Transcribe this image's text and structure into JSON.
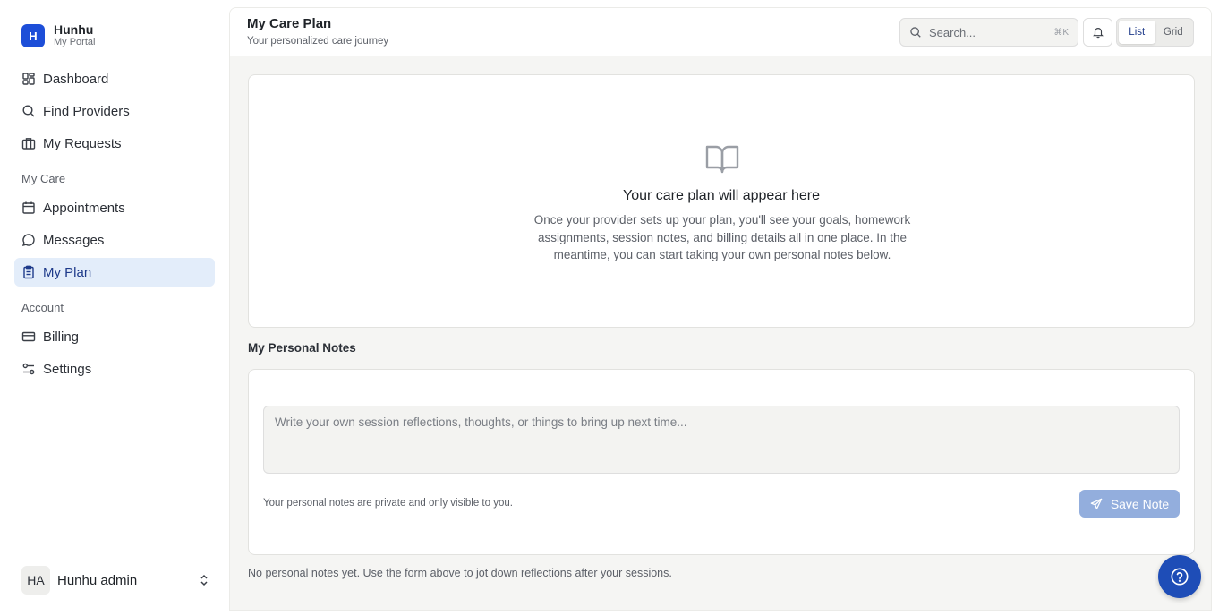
{
  "brand": {
    "logo_letter": "H",
    "name": "Hunhu",
    "subtitle": "My Portal"
  },
  "sidebar": {
    "primary_items": [
      {
        "label": "Dashboard",
        "icon": "dashboard-icon"
      },
      {
        "label": "Find Providers",
        "icon": "search-icon"
      },
      {
        "label": "My Requests",
        "icon": "briefcase-icon"
      }
    ],
    "my_care_label": "My Care",
    "my_care_items": [
      {
        "label": "Appointments",
        "icon": "calendar-icon"
      },
      {
        "label": "Messages",
        "icon": "message-icon"
      },
      {
        "label": "My Plan",
        "icon": "clipboard-icon",
        "active": true
      }
    ],
    "account_label": "Account",
    "account_items": [
      {
        "label": "Billing",
        "icon": "credit-card-icon"
      },
      {
        "label": "Settings",
        "icon": "sliders-icon"
      }
    ],
    "user": {
      "initials": "HA",
      "name": "Hunhu admin"
    }
  },
  "header": {
    "title": "My Care Plan",
    "subtitle": "Your personalized care journey",
    "search_placeholder": "Search...",
    "search_shortcut": "⌘K",
    "view_toggle": {
      "list_label": "List",
      "grid_label": "Grid",
      "selected": "List"
    }
  },
  "empty_state": {
    "icon": "book-open-icon",
    "title": "Your care plan will appear here",
    "body": "Once your provider sets up your plan, you'll see your goals, homework assignments, session notes, and billing details all in one place. In the meantime, you can start taking your own personal notes below."
  },
  "personal_notes": {
    "heading": "My Personal Notes",
    "placeholder": "Write your own session reflections, thoughts, or things to bring up next time...",
    "privacy_text": "Your personal notes are private and only visible to you.",
    "save_label": "Save Note",
    "empty_text": "No personal notes yet. Use the form above to jot down reflections after your sessions."
  },
  "colors": {
    "accent": "#1d4ed8",
    "active_nav_bg": "#e3edfa",
    "save_button_disabled": "#93aedd",
    "help_fab": "#1e4db7"
  }
}
